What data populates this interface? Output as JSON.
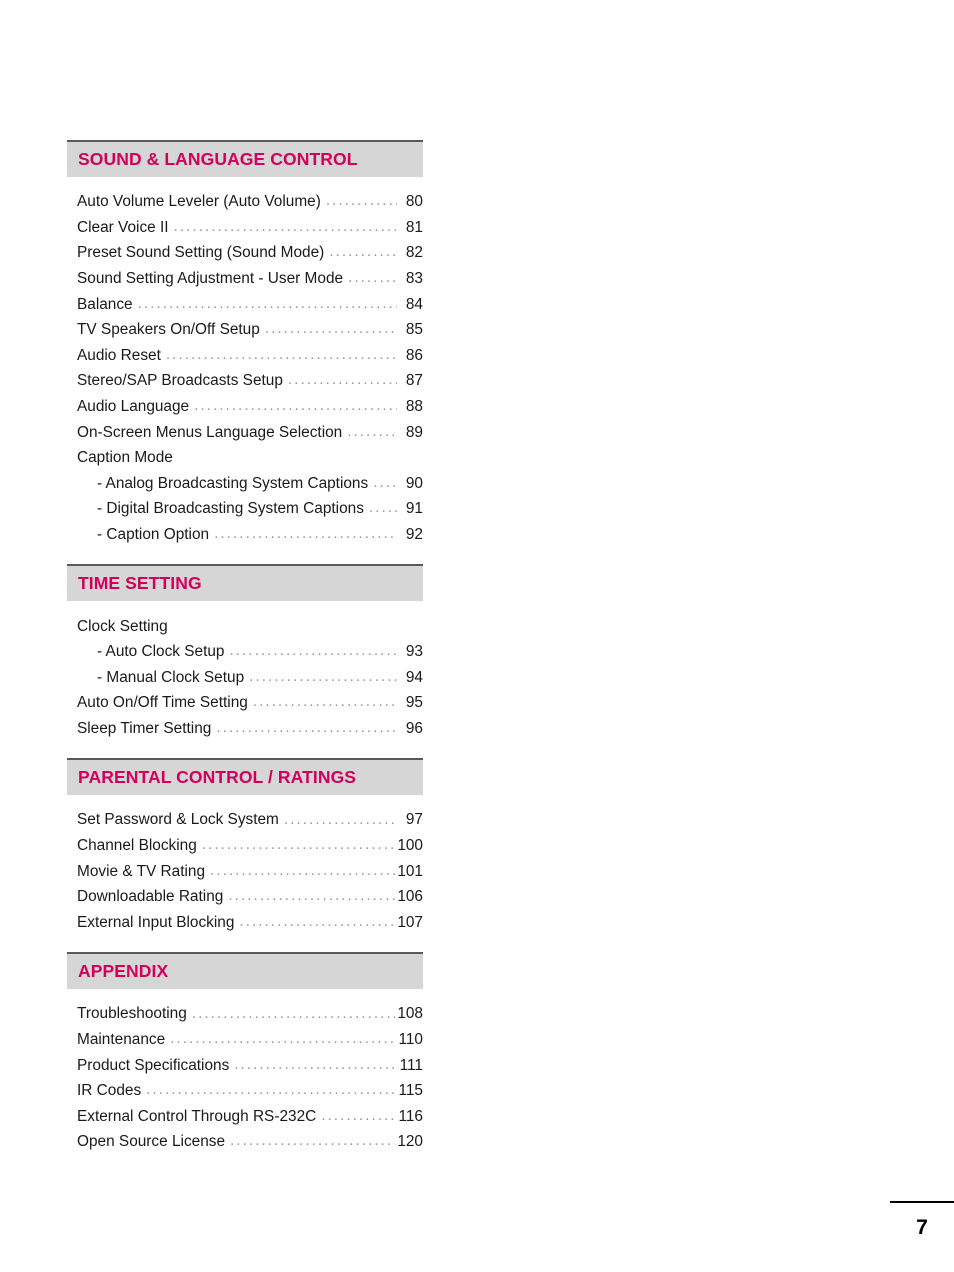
{
  "document": {
    "page_number": "7"
  },
  "toc": {
    "sections": [
      {
        "title": "SOUND & LANGUAGE CONTROL",
        "entries": [
          {
            "label": "Auto Volume Leveler (Auto Volume)",
            "page": "80",
            "sub": false
          },
          {
            "label": "Clear Voice II",
            "page": "81",
            "sub": false
          },
          {
            "label": "Preset Sound Setting (Sound Mode)",
            "page": "82",
            "sub": false
          },
          {
            "label": "Sound Setting Adjustment - User Mode",
            "page": "83",
            "sub": false
          },
          {
            "label": "Balance",
            "page": "84",
            "sub": false
          },
          {
            "label": "TV Speakers On/Off Setup",
            "page": "85",
            "sub": false
          },
          {
            "label": "Audio Reset",
            "page": "86",
            "sub": false
          },
          {
            "label": "Stereo/SAP Broadcasts Setup",
            "page": "87",
            "sub": false
          },
          {
            "label": "Audio Language",
            "page": "88",
            "sub": false
          },
          {
            "label": "On-Screen Menus Language Selection",
            "page": "89",
            "sub": false
          },
          {
            "label": "Caption Mode",
            "page": "",
            "sub": false
          },
          {
            "label": "- Analog Broadcasting System Captions",
            "page": "90",
            "sub": true
          },
          {
            "label": "- Digital Broadcasting System Captions",
            "page": "91",
            "sub": true
          },
          {
            "label": "- Caption Option",
            "page": "92",
            "sub": true
          }
        ]
      },
      {
        "title": "TIME SETTING",
        "entries": [
          {
            "label": "Clock Setting",
            "page": "",
            "sub": false
          },
          {
            "label": "- Auto Clock Setup",
            "page": "93",
            "sub": true
          },
          {
            "label": "- Manual Clock Setup",
            "page": "94",
            "sub": true
          },
          {
            "label": "Auto On/Off Time Setting",
            "page": "95",
            "sub": false
          },
          {
            "label": "Sleep Timer Setting",
            "page": "96",
            "sub": false
          }
        ]
      },
      {
        "title": "PARENTAL CONTROL / RATINGS",
        "entries": [
          {
            "label": "Set Password & Lock System",
            "page": "97",
            "sub": false
          },
          {
            "label": "Channel Blocking",
            "page": "100",
            "sub": false
          },
          {
            "label": "Movie & TV Rating",
            "page": "101",
            "sub": false
          },
          {
            "label": "Downloadable Rating",
            "page": "106",
            "sub": false
          },
          {
            "label": "External Input Blocking",
            "page": "107",
            "sub": false
          }
        ]
      },
      {
        "title": "APPENDIX",
        "entries": [
          {
            "label": "Troubleshooting",
            "page": "108",
            "sub": false
          },
          {
            "label": "Maintenance",
            "page": "110",
            "sub": false
          },
          {
            "label": "Product Specifications",
            "page": "111",
            "sub": false
          },
          {
            "label": "IR Codes",
            "page": "115",
            "sub": false
          },
          {
            "label": "External Control Through RS-232C",
            "page": "116",
            "sub": false
          },
          {
            "label": "Open Source License",
            "page": "120",
            "sub": false
          }
        ]
      }
    ]
  },
  "colors": {
    "heading_text": "#d1005d",
    "band_background": "#d6d6d6",
    "band_rule": "#58595b",
    "body_text": "#1a1a1a",
    "leader_dots": "#9a9a9a"
  }
}
